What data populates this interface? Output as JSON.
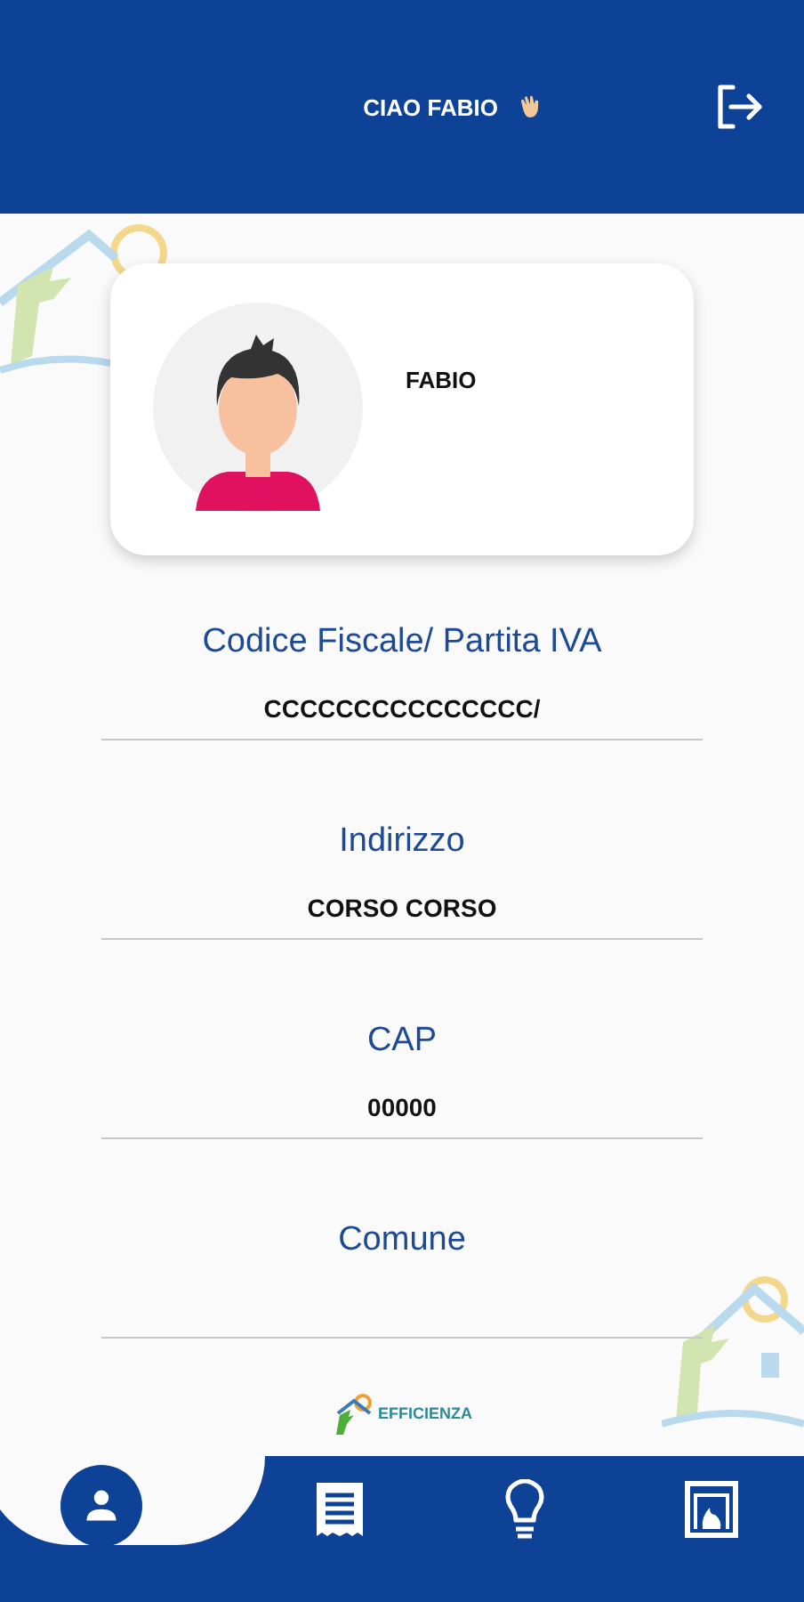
{
  "header": {
    "greeting": "CIAO FABIO"
  },
  "profile": {
    "name": "FABIO"
  },
  "fields": [
    {
      "label": "Codice Fiscale/ Partita IVA",
      "value": "CCCCCCCCCCCCCCC/"
    },
    {
      "label": "Indirizzo",
      "value": "CORSO CORSO"
    },
    {
      "label": "CAP",
      "value": "00000"
    },
    {
      "label": "Comune"
    }
  ],
  "footer_logo": {
    "text": "EFFICIENZA"
  },
  "bottom_nav": [
    {
      "kind": "profile",
      "selected": true
    },
    {
      "kind": "receipt",
      "selected": false
    },
    {
      "kind": "bulb",
      "selected": false
    },
    {
      "kind": "fireplace",
      "selected": false
    }
  ]
}
